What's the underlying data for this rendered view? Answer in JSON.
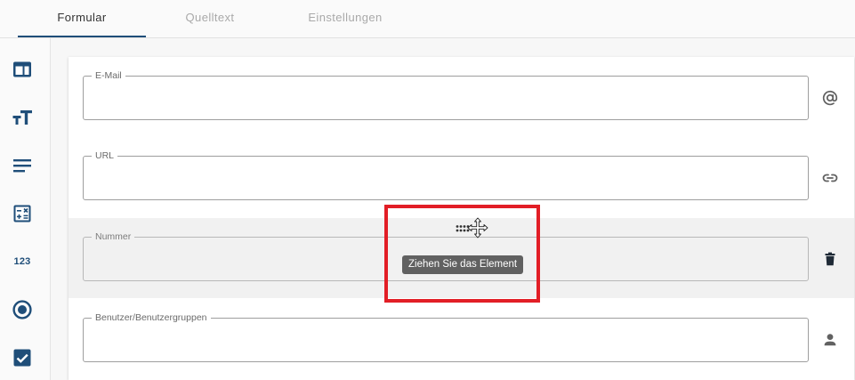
{
  "tabs": [
    {
      "label": "Formular",
      "active": true
    },
    {
      "label": "Quelltext",
      "active": false
    },
    {
      "label": "Einstellungen",
      "active": false
    }
  ],
  "sidebar": {
    "tools": [
      {
        "icon": "layout-icon"
      },
      {
        "icon": "text-size-icon"
      },
      {
        "icon": "paragraph-icon"
      },
      {
        "icon": "calculator-icon"
      },
      {
        "icon": "number-icon",
        "text": "123"
      },
      {
        "icon": "radio-icon"
      },
      {
        "icon": "checkbox-icon"
      }
    ]
  },
  "fields": [
    {
      "label": "E-Mail",
      "icon": "at-icon"
    },
    {
      "label": "URL",
      "icon": "link-icon"
    },
    {
      "label": "Nummer",
      "icon": "trash-icon"
    },
    {
      "label": "Benutzer/Benutzergruppen",
      "icon": "person-icon"
    }
  ],
  "tooltip": {
    "text": "Ziehen Sie das Element"
  },
  "colors": {
    "accent": "#1f4e79",
    "highlight": "#e21e26",
    "tooltip_bg": "#616161"
  }
}
